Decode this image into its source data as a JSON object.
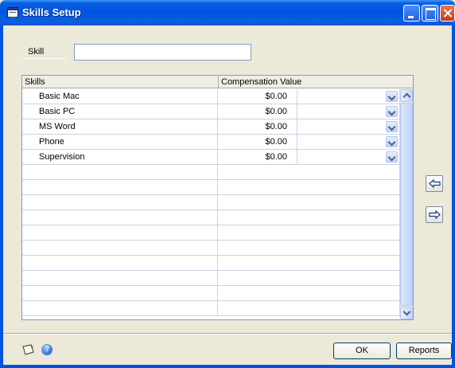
{
  "window": {
    "title": "Skills Setup"
  },
  "form": {
    "skill_label": "Skill",
    "skill_value": ""
  },
  "grid": {
    "columns": [
      "Skills",
      "Compensation Value"
    ],
    "rows": [
      {
        "skill": "Basic Mac",
        "compensation": "$0.00"
      },
      {
        "skill": "Basic PC",
        "compensation": "$0.00"
      },
      {
        "skill": "MS Word",
        "compensation": "$0.00"
      },
      {
        "skill": "Phone",
        "compensation": "$0.00"
      },
      {
        "skill": "Supervision",
        "compensation": "$0.00"
      }
    ],
    "empty_rows": 10
  },
  "buttons": {
    "ok": "OK",
    "reports": "Reports"
  },
  "icons": {
    "window": "form-icon",
    "move_up": "arrow-left-icon",
    "move_down": "arrow-right-icon",
    "note": "note-icon",
    "help": "help-icon"
  },
  "colors": {
    "titlebar": "#0053e0",
    "body": "#ece9d8",
    "close": "#c43a1a"
  }
}
